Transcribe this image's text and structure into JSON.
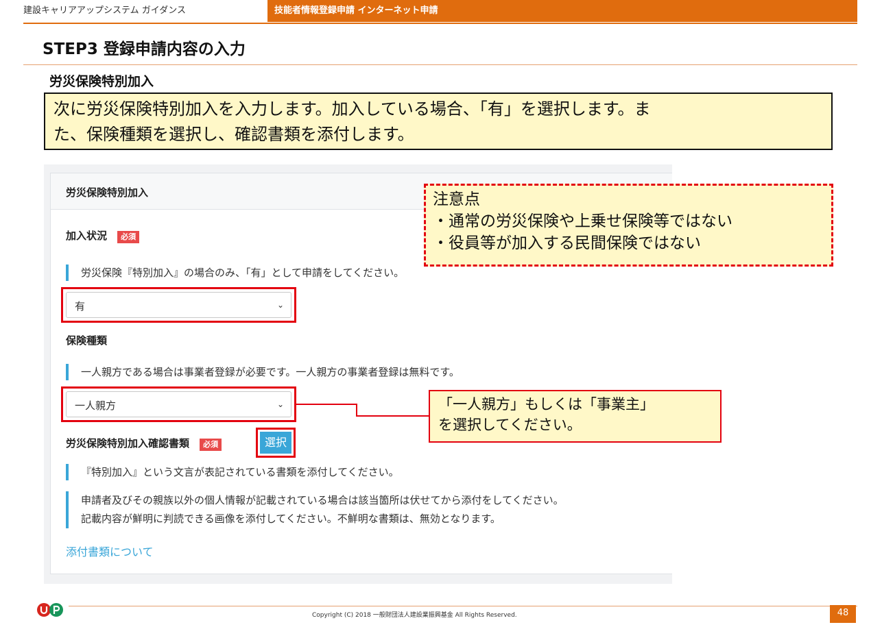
{
  "header": {
    "guide_title": "建設キャリアアップシステム ガイダンス",
    "section": "技能者情報登録申請 インターネット申請"
  },
  "page": {
    "step_title": "STEP3 登録申請内容の入力",
    "section_title": "労災保険特別加入",
    "explain_line1": "次に労災保険特別加入を入力します。加入している場合、「有」を選択します。ま",
    "explain_line2": "た、保険種類を選択し、確認書類を添付します。"
  },
  "panel": {
    "heading": "労災保険特別加入",
    "status_label": "加入状況",
    "required_badge": "必須",
    "status_note": "労災保険『特別加入』の場合のみ、「有」として申請をしてください。",
    "status_value": "有",
    "type_label": "保険種類",
    "type_note": "一人親方である場合は事業者登録が必要です。一人親方の事業者登録は無料です。",
    "type_value": "一人親方",
    "doc_label": "労災保険特別加入確認書類",
    "select_button": "選択",
    "doc_note": "『特別加入』という文言が表記されている書類を添付してください。",
    "privacy_note_1": "申請者及びその親族以外の個人情報が記載されている場合は該当箇所は伏せてから添付をしてください。",
    "privacy_note_2": "記載内容が鮮明に判読できる画像を添付してください。不鮮明な書類は、無効となります。",
    "attach_link": "添付書類について"
  },
  "callouts": {
    "caution_title": "注意点",
    "caution_1": "・通常の労災保険や上乗せ保険等ではない",
    "caution_2": "・役員等が加入する民間保険ではない",
    "hint_1": "「一人親方」もしくは「事業主」",
    "hint_2": "を選択してください。"
  },
  "footer": {
    "copyright": "Copyright (C) 2018 一般財団法人建設業振興基金 All Rights Reserved.",
    "page_number": "48"
  },
  "colors": {
    "accent_orange": "#e06c0e",
    "highlight_red": "#e3000f",
    "link_blue": "#3aa6d8",
    "note_yellow": "#fff8c8"
  }
}
